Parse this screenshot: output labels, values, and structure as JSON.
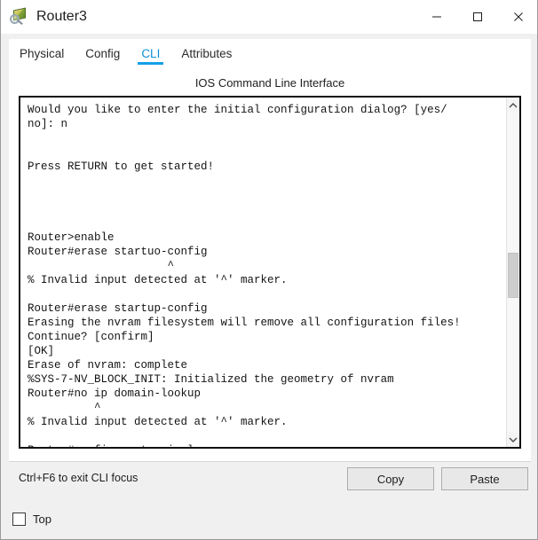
{
  "window": {
    "title": "Router3",
    "icon": "router-device-icon",
    "controls": {
      "minimize_label": "Minimize",
      "maximize_label": "Maximize",
      "close_label": "Close"
    }
  },
  "tabs": [
    {
      "label": "Physical",
      "active": false
    },
    {
      "label": "Config",
      "active": false
    },
    {
      "label": "CLI",
      "active": true
    },
    {
      "label": "Attributes",
      "active": false
    }
  ],
  "panel": {
    "header": "IOS Command Line Interface"
  },
  "terminal": {
    "lines": [
      "Would you like to enter the initial configuration dialog? [yes/",
      "no]: n",
      "",
      "",
      "Press RETURN to get started!",
      "",
      "",
      "",
      "",
      "Router>enable",
      "Router#erase startuo-config",
      "                     ^",
      "% Invalid input detected at '^' marker.",
      "",
      "Router#erase startup-config",
      "Erasing the nvram filesystem will remove all configuration files!",
      "Continue? [confirm]",
      "[OK]",
      "Erase of nvram: complete",
      "%SYS-7-NV_BLOCK_INIT: Initialized the geometry of nvram",
      "Router#no ip domain-lookup",
      "          ^",
      "% Invalid input detected at '^' marker.",
      "",
      "Router#configure terminal"
    ]
  },
  "scrollbar": {
    "up_arrow": "chevron-up-icon",
    "down_arrow": "chevron-down-icon",
    "thumb_top_pct": 44,
    "thumb_height_pct": 14
  },
  "bottom": {
    "hint": "Ctrl+F6 to exit CLI focus",
    "copy_label": "Copy",
    "paste_label": "Paste"
  },
  "footer": {
    "top_checkbox_label": "Top",
    "top_checkbox_checked": false
  },
  "colors": {
    "accent": "#11a0e8",
    "active_tab_text": "#0f8fd8",
    "window_bg": "#f0f0f0",
    "panel_bg": "#ffffff",
    "terminal_text": "#141414",
    "terminal_border": "#111111"
  }
}
